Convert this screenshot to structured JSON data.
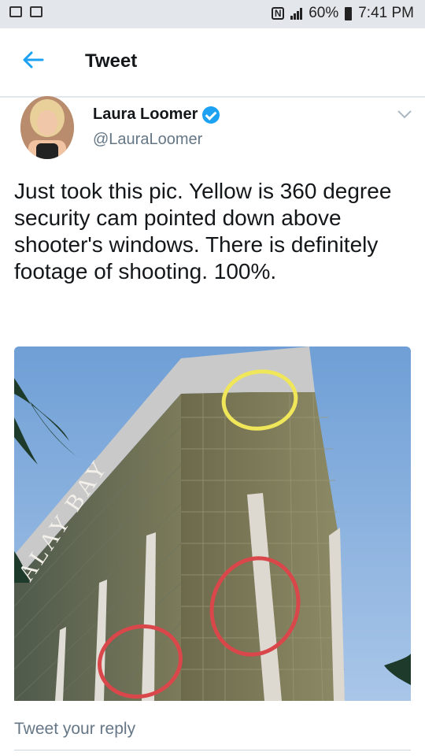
{
  "status": {
    "battery": "60%",
    "time": "7:41 PM"
  },
  "header": {
    "title": "Tweet"
  },
  "tweet": {
    "author_name": "Laura Loomer",
    "author_handle": "@LauraLoomer",
    "text": "Just took this pic. Yellow is 360 degree security cam pointed down above shooter's windows. There is definitely footage of shooting. 100%.",
    "photo_sign_text": "ALAY BAY"
  },
  "reply": {
    "placeholder": "Tweet your reply"
  },
  "colors": {
    "accent": "#1da1f2",
    "yellow_circle": "#f0e65a",
    "red_circle": "#d9474b"
  }
}
